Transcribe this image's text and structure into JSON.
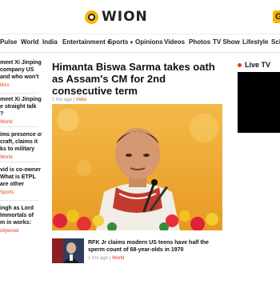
{
  "header": {
    "logo_text": "WION",
    "right_chip": "G"
  },
  "nav": {
    "items": [
      {
        "label": "Pulse"
      },
      {
        "label": "World"
      },
      {
        "label": "India"
      },
      {
        "label": "Entertainment",
        "has_dropdown": true
      },
      {
        "label": "Sports",
        "has_dropdown": true
      },
      {
        "label": "Opinions"
      },
      {
        "label": "Videos"
      },
      {
        "label": "Photos"
      },
      {
        "label": "TV Show"
      },
      {
        "label": "Lifestyle"
      },
      {
        "label": "Scie"
      }
    ]
  },
  "left_stories": [
    {
      "lines": [
        "meet Xi Jinping:",
        "company US",
        "and who won't"
      ],
      "tag": "litics"
    },
    {
      "lines": [
        "meet Xi Jinping:",
        "e straight talk",
        "?"
      ],
      "tag": "World"
    },
    {
      "lines": [
        "ims presence of",
        "craft, claims it",
        "ks to military"
      ],
      "tag": "World"
    },
    {
      "lines": [
        "vid is co-owner",
        "What is ETPL",
        "are other"
      ],
      "tag": "Sports"
    },
    {
      "lines": [
        "ingh as Lord",
        "Immortals of",
        "m in works:"
      ],
      "tag": "ollywood"
    }
  ],
  "main": {
    "headline": "Himanta Biswa Sarma takes oath as Assam's CM for 2nd consecutive term",
    "time": "1 hrs ago",
    "separator": "|",
    "category": "India",
    "secondary": {
      "title": "RFK Jr claims modern US teens have half the sperm count of 68-year-olds in 1970",
      "time": "1 hrs ago",
      "separator": "|",
      "category": "World"
    }
  },
  "sidebar": {
    "live_label": "Live TV"
  }
}
